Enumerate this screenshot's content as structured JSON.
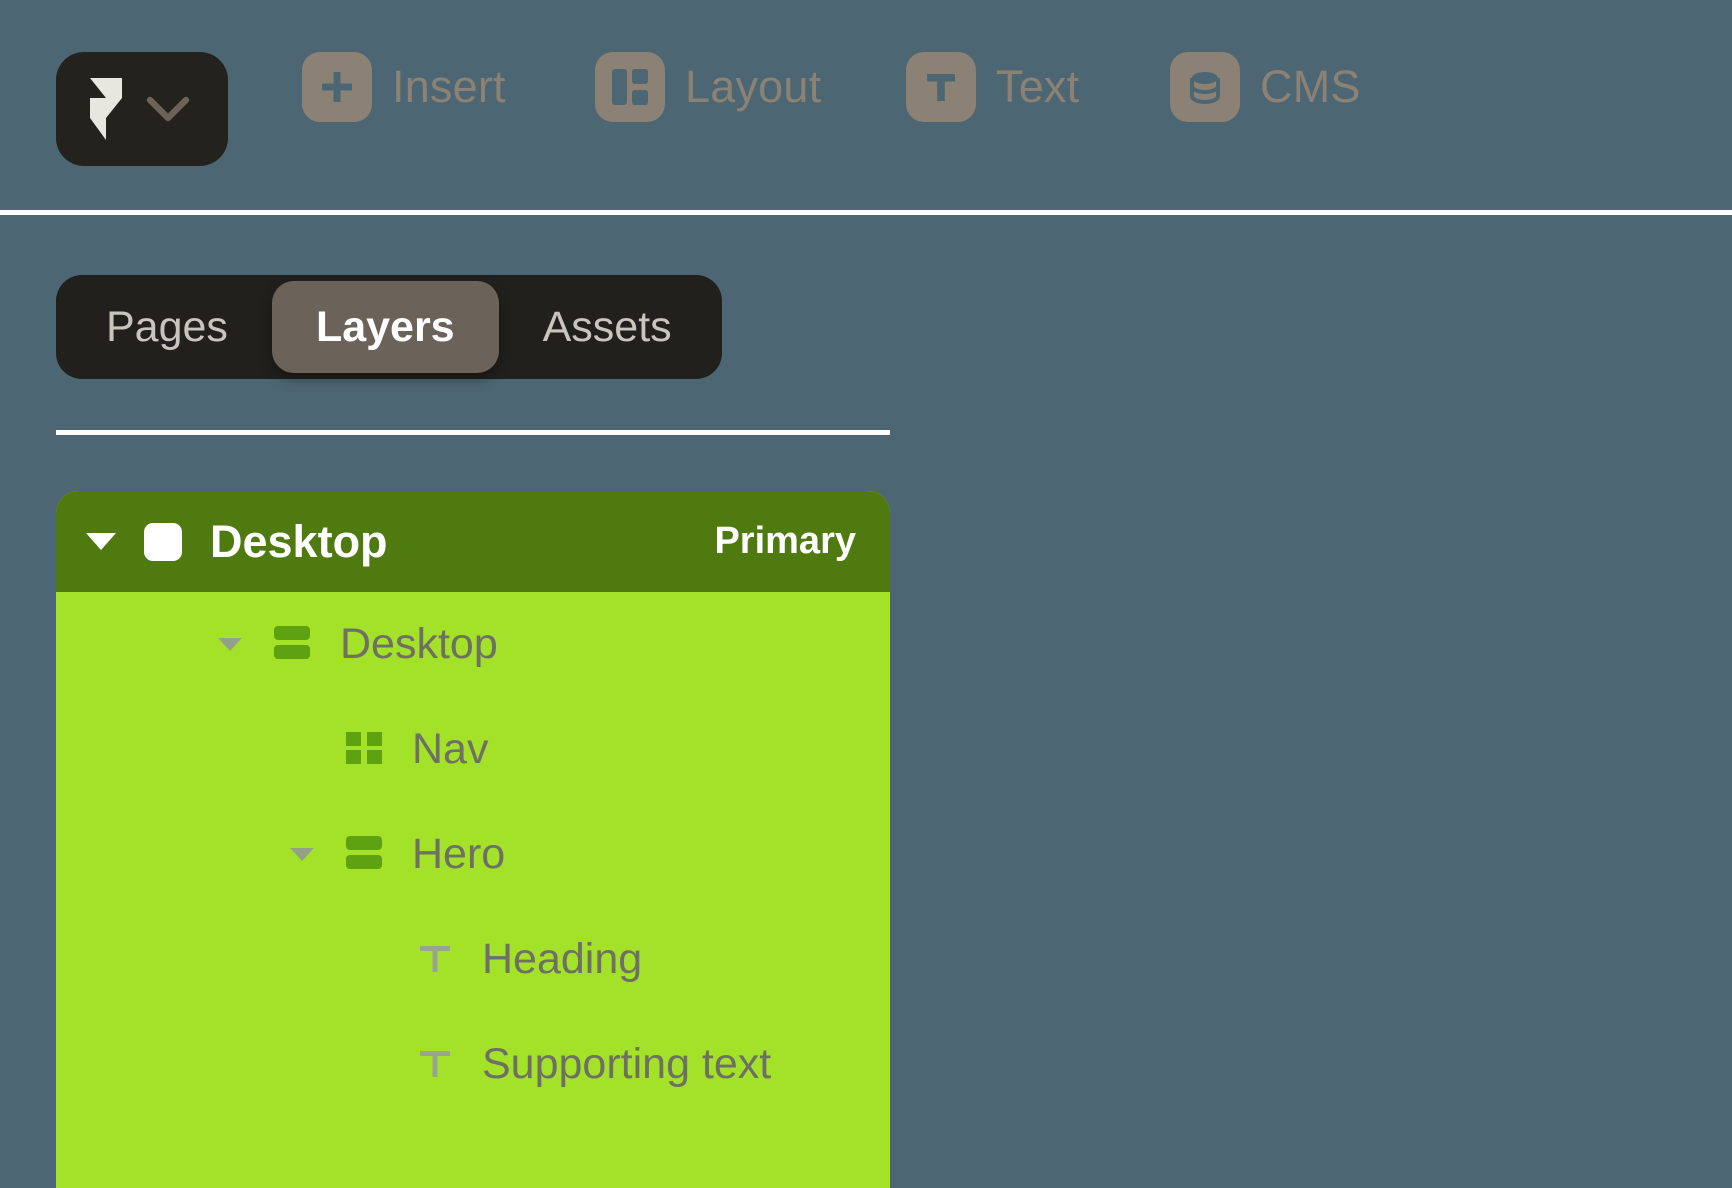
{
  "app": {
    "background_color": "#4c6673",
    "logo_name": "framer-logo"
  },
  "toolbar": {
    "items": [
      {
        "icon": "plus-icon",
        "label": "Insert"
      },
      {
        "icon": "layout-icon",
        "label": "Layout"
      },
      {
        "icon": "text-t-icon",
        "label": "Text"
      },
      {
        "icon": "database-icon",
        "label": "CMS"
      }
    ],
    "icon_color": "#8b8175",
    "label_color": "#8b8175"
  },
  "tabs": {
    "items": [
      {
        "label": "Pages",
        "active": false
      },
      {
        "label": "Layers",
        "active": true
      },
      {
        "label": "Assets",
        "active": false
      }
    ],
    "container_color": "#22201c",
    "active_color": "#6b635a"
  },
  "layers": {
    "header": {
      "title": "Desktop",
      "badge": "Primary",
      "color": "#4e7a10",
      "icon": "frame-icon",
      "caret": "caret-down-icon"
    },
    "body_color": "#a4e229",
    "icon_color": "#5fa211",
    "label_color": "#6e7066",
    "rows": [
      {
        "label": "Desktop",
        "icon": "stack-icon",
        "indent": 0,
        "caret": true
      },
      {
        "label": "Nav",
        "icon": "component-icon",
        "indent": 1,
        "caret": false
      },
      {
        "label": "Hero",
        "icon": "stack-icon",
        "indent": 1,
        "caret": true
      },
      {
        "label": "Heading",
        "icon": "text-t-icon",
        "indent": 2,
        "caret": false
      },
      {
        "label": "Supporting text",
        "icon": "text-t-icon",
        "indent": 2,
        "caret": false
      }
    ]
  }
}
